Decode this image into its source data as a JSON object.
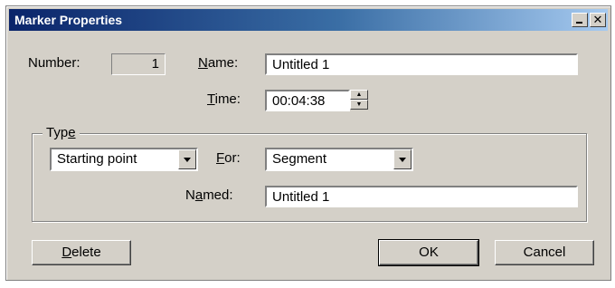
{
  "window": {
    "title": "Marker Properties"
  },
  "number": {
    "label": "Number:",
    "value": "1"
  },
  "name": {
    "label_u": "N",
    "label_rest": "ame:",
    "value": "Untitled 1"
  },
  "time": {
    "label_u": "T",
    "label_rest": "ime:",
    "value": "00:04:38"
  },
  "type_group": {
    "legend_pre": "Typ",
    "legend_u": "e",
    "type_value": "Starting point",
    "for_label_u": "F",
    "for_label_rest": "or:",
    "for_value": "Segment",
    "named_label_pre": "N",
    "named_label_u": "a",
    "named_label_rest": "med:",
    "named_value": "Untitled 1"
  },
  "buttons": {
    "delete_u": "D",
    "delete_rest": "elete",
    "ok": "OK",
    "cancel": "Cancel"
  },
  "icons": {
    "minimize": "minimize-icon",
    "close": "close-icon",
    "spin": "spin-arrows-icon",
    "dropdown": "chevron-down-icon"
  }
}
